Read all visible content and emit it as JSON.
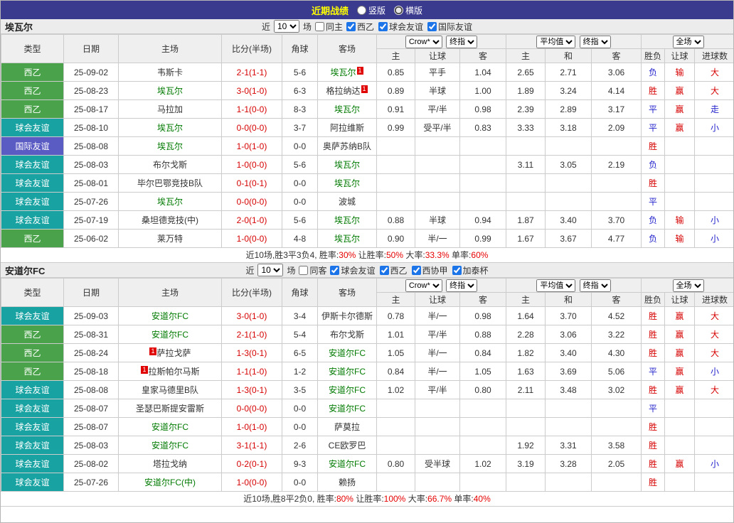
{
  "colors": {
    "title_bar": "#3a3a8e",
    "laliga2_green": "#4aa34a",
    "club_friendly_teal": "#18a2a2",
    "intl_friendly_blue": "#5b5bc4",
    "score_red": "#d60000",
    "self_team_green": "#007a00",
    "win_red": "#d60000",
    "draw_lose_blue": "#2323cc",
    "summary_red": "#e60000",
    "checkbox_blue": "#1c74e9"
  },
  "top_bar": {
    "title": "近期战绩",
    "radios": [
      {
        "label": "竖版",
        "checked": false
      },
      {
        "label": "横版",
        "checked": true
      }
    ]
  },
  "headers": {
    "type": "类型",
    "date": "日期",
    "home": "主场",
    "score": "比分(半场)",
    "corner": "角球",
    "away": "客场",
    "book": "Crow*",
    "final1": "终指",
    "avg": "平均值",
    "final2": "终指",
    "full": "全场",
    "sub": [
      "主",
      "让球",
      "客",
      "主",
      "和",
      "客",
      "胜负",
      "让球",
      "进球数"
    ]
  },
  "sections": [
    {
      "team": "埃瓦尔",
      "filter": {
        "near": "近",
        "count": "10",
        "games": "场",
        "same": "同主",
        "same_checked": false,
        "leagues": [
          {
            "label": "西乙",
            "checked": true
          },
          {
            "label": "球会友谊",
            "checked": true
          },
          {
            "label": "国际友谊",
            "checked": true
          }
        ]
      },
      "rows": [
        {
          "type": {
            "text": "西乙",
            "cls": "t-green"
          },
          "date": "25-09-02",
          "home": {
            "pre": "",
            "text": "韦斯卡",
            "post": "",
            "cls": ""
          },
          "score": "2-1(1-1)",
          "corner": "5-6",
          "away": {
            "pre": "",
            "text": "埃瓦尔",
            "post": "1",
            "cls": "green"
          },
          "o1": "0.85",
          "o2": "平手",
          "o3": "1.04",
          "a1": "2.65",
          "a2": "2.71",
          "a3": "3.06",
          "r1": {
            "t": "负",
            "c": "blue"
          },
          "r2": {
            "t": "输",
            "c": "red"
          },
          "r3": {
            "t": "大",
            "c": "red"
          }
        },
        {
          "type": {
            "text": "西乙",
            "cls": "t-green"
          },
          "date": "25-08-23",
          "home": {
            "pre": "",
            "text": "埃瓦尔",
            "post": "",
            "cls": "green"
          },
          "score": "3-0(1-0)",
          "corner": "6-3",
          "away": {
            "pre": "",
            "text": "格拉纳达",
            "post": "1",
            "cls": ""
          },
          "o1": "0.89",
          "o2": "半球",
          "o3": "1.00",
          "a1": "1.89",
          "a2": "3.24",
          "a3": "4.14",
          "r1": {
            "t": "胜",
            "c": "red"
          },
          "r2": {
            "t": "赢",
            "c": "red"
          },
          "r3": {
            "t": "大",
            "c": "red"
          }
        },
        {
          "type": {
            "text": "西乙",
            "cls": "t-green"
          },
          "date": "25-08-17",
          "home": {
            "pre": "",
            "text": "马拉加",
            "post": "",
            "cls": ""
          },
          "score": "1-1(0-0)",
          "corner": "8-3",
          "away": {
            "pre": "",
            "text": "埃瓦尔",
            "post": "",
            "cls": "green"
          },
          "o1": "0.91",
          "o2": "平/半",
          "o3": "0.98",
          "a1": "2.39",
          "a2": "2.89",
          "a3": "3.17",
          "r1": {
            "t": "平",
            "c": "blue"
          },
          "r2": {
            "t": "赢",
            "c": "red"
          },
          "r3": {
            "t": "走",
            "c": "blue"
          }
        },
        {
          "type": {
            "text": "球会友谊",
            "cls": "t-teal"
          },
          "date": "25-08-10",
          "home": {
            "pre": "",
            "text": "埃瓦尔",
            "post": "",
            "cls": "green"
          },
          "score": "0-0(0-0)",
          "corner": "3-7",
          "away": {
            "pre": "",
            "text": "阿拉维斯",
            "post": "",
            "cls": ""
          },
          "o1": "0.99",
          "o2": "受平/半",
          "o3": "0.83",
          "a1": "3.33",
          "a2": "3.18",
          "a3": "2.09",
          "r1": {
            "t": "平",
            "c": "blue"
          },
          "r2": {
            "t": "赢",
            "c": "red"
          },
          "r3": {
            "t": "小",
            "c": "blue"
          }
        },
        {
          "type": {
            "text": "国际友谊",
            "cls": "t-blue"
          },
          "date": "25-08-08",
          "home": {
            "pre": "",
            "text": "埃瓦尔",
            "post": "",
            "cls": "green"
          },
          "score": "1-0(1-0)",
          "corner": "0-0",
          "away": {
            "pre": "",
            "text": "奥萨苏纳B队",
            "post": "",
            "cls": ""
          },
          "o1": "",
          "o2": "",
          "o3": "",
          "a1": "",
          "a2": "",
          "a3": "",
          "r1": {
            "t": "胜",
            "c": "red"
          },
          "r2": {
            "t": "",
            "c": ""
          },
          "r3": {
            "t": "",
            "c": ""
          }
        },
        {
          "type": {
            "text": "球会友谊",
            "cls": "t-teal"
          },
          "date": "25-08-03",
          "home": {
            "pre": "",
            "text": "布尔戈斯",
            "post": "",
            "cls": ""
          },
          "score": "1-0(0-0)",
          "corner": "5-6",
          "away": {
            "pre": "",
            "text": "埃瓦尔",
            "post": "",
            "cls": "green"
          },
          "o1": "",
          "o2": "",
          "o3": "",
          "a1": "3.11",
          "a2": "3.05",
          "a3": "2.19",
          "r1": {
            "t": "负",
            "c": "blue"
          },
          "r2": {
            "t": "",
            "c": ""
          },
          "r3": {
            "t": "",
            "c": ""
          }
        },
        {
          "type": {
            "text": "球会友谊",
            "cls": "t-teal"
          },
          "date": "25-08-01",
          "home": {
            "pre": "",
            "text": "毕尔巴鄂竞技B队",
            "post": "",
            "cls": ""
          },
          "score": "0-1(0-1)",
          "corner": "0-0",
          "away": {
            "pre": "",
            "text": "埃瓦尔",
            "post": "",
            "cls": "green"
          },
          "o1": "",
          "o2": "",
          "o3": "",
          "a1": "",
          "a2": "",
          "a3": "",
          "r1": {
            "t": "胜",
            "c": "red"
          },
          "r2": {
            "t": "",
            "c": ""
          },
          "r3": {
            "t": "",
            "c": ""
          }
        },
        {
          "type": {
            "text": "球会友谊",
            "cls": "t-teal"
          },
          "date": "25-07-26",
          "home": {
            "pre": "",
            "text": "埃瓦尔",
            "post": "",
            "cls": "green"
          },
          "score": "0-0(0-0)",
          "corner": "0-0",
          "away": {
            "pre": "",
            "text": "波城",
            "post": "",
            "cls": ""
          },
          "o1": "",
          "o2": "",
          "o3": "",
          "a1": "",
          "a2": "",
          "a3": "",
          "r1": {
            "t": "平",
            "c": "blue"
          },
          "r2": {
            "t": "",
            "c": ""
          },
          "r3": {
            "t": "",
            "c": ""
          }
        },
        {
          "type": {
            "text": "球会友谊",
            "cls": "t-teal"
          },
          "date": "25-07-19",
          "home": {
            "pre": "",
            "text": "桑坦德竞技(中)",
            "post": "",
            "cls": ""
          },
          "score": "2-0(1-0)",
          "corner": "5-6",
          "away": {
            "pre": "",
            "text": "埃瓦尔",
            "post": "",
            "cls": "green"
          },
          "o1": "0.88",
          "o2": "半球",
          "o3": "0.94",
          "a1": "1.87",
          "a2": "3.40",
          "a3": "3.70",
          "r1": {
            "t": "负",
            "c": "blue"
          },
          "r2": {
            "t": "输",
            "c": "red"
          },
          "r3": {
            "t": "小",
            "c": "blue"
          }
        },
        {
          "type": {
            "text": "西乙",
            "cls": "t-green"
          },
          "date": "25-06-02",
          "home": {
            "pre": "",
            "text": "莱万特",
            "post": "",
            "cls": ""
          },
          "score": "1-0(0-0)",
          "corner": "4-8",
          "away": {
            "pre": "",
            "text": "埃瓦尔",
            "post": "",
            "cls": "green"
          },
          "o1": "0.90",
          "o2": "半/一",
          "o3": "0.99",
          "a1": "1.67",
          "a2": "3.67",
          "a3": "4.77",
          "r1": {
            "t": "负",
            "c": "blue"
          },
          "r2": {
            "t": "输",
            "c": "red"
          },
          "r3": {
            "t": "小",
            "c": "blue"
          }
        }
      ],
      "summary": [
        {
          "t": "近10场,胜3平3负4, 胜率:",
          "c": ""
        },
        {
          "t": "30%",
          "c": "r"
        },
        {
          "t": " 让胜率:",
          "c": ""
        },
        {
          "t": "50%",
          "c": "r"
        },
        {
          "t": " 大率:",
          "c": ""
        },
        {
          "t": "33.3%",
          "c": "r"
        },
        {
          "t": " 单率:",
          "c": ""
        },
        {
          "t": "60%",
          "c": "r"
        }
      ]
    },
    {
      "team": "安道尔FC",
      "filter": {
        "near": "近",
        "count": "10",
        "games": "场",
        "same": "同客",
        "same_checked": false,
        "leagues": [
          {
            "label": "球会友谊",
            "checked": true
          },
          {
            "label": "西乙",
            "checked": true
          },
          {
            "label": "西协甲",
            "checked": true
          },
          {
            "label": "加泰杯",
            "checked": true
          }
        ]
      },
      "rows": [
        {
          "type": {
            "text": "球会友谊",
            "cls": "t-teal"
          },
          "date": "25-09-03",
          "home": {
            "pre": "",
            "text": "安道尔FC",
            "post": "",
            "cls": "green"
          },
          "score": "3-0(1-0)",
          "corner": "3-4",
          "away": {
            "pre": "",
            "text": "伊斯卡尔德斯",
            "post": "",
            "cls": ""
          },
          "o1": "0.78",
          "o2": "半/一",
          "o3": "0.98",
          "a1": "1.64",
          "a2": "3.70",
          "a3": "4.52",
          "r1": {
            "t": "胜",
            "c": "red"
          },
          "r2": {
            "t": "赢",
            "c": "red"
          },
          "r3": {
            "t": "大",
            "c": "red"
          }
        },
        {
          "type": {
            "text": "西乙",
            "cls": "t-green"
          },
          "date": "25-08-31",
          "home": {
            "pre": "",
            "text": "安道尔FC",
            "post": "",
            "cls": "green"
          },
          "score": "2-1(1-0)",
          "corner": "5-4",
          "away": {
            "pre": "",
            "text": "布尔戈斯",
            "post": "",
            "cls": ""
          },
          "o1": "1.01",
          "o2": "平/半",
          "o3": "0.88",
          "a1": "2.28",
          "a2": "3.06",
          "a3": "3.22",
          "r1": {
            "t": "胜",
            "c": "red"
          },
          "r2": {
            "t": "赢",
            "c": "red"
          },
          "r3": {
            "t": "大",
            "c": "red"
          }
        },
        {
          "type": {
            "text": "西乙",
            "cls": "t-green"
          },
          "date": "25-08-24",
          "home": {
            "pre": "1",
            "text": "萨拉戈萨",
            "post": "",
            "cls": ""
          },
          "score": "1-3(0-1)",
          "corner": "6-5",
          "away": {
            "pre": "",
            "text": "安道尔FC",
            "post": "",
            "cls": "green"
          },
          "o1": "1.05",
          "o2": "半/一",
          "o3": "0.84",
          "a1": "1.82",
          "a2": "3.40",
          "a3": "4.30",
          "r1": {
            "t": "胜",
            "c": "red"
          },
          "r2": {
            "t": "赢",
            "c": "red"
          },
          "r3": {
            "t": "大",
            "c": "red"
          }
        },
        {
          "type": {
            "text": "西乙",
            "cls": "t-green"
          },
          "date": "25-08-18",
          "home": {
            "pre": "1",
            "text": "拉斯帕尔马斯",
            "post": "",
            "cls": ""
          },
          "score": "1-1(1-0)",
          "corner": "1-2",
          "away": {
            "pre": "",
            "text": "安道尔FC",
            "post": "",
            "cls": "green"
          },
          "o1": "0.84",
          "o2": "半/一",
          "o3": "1.05",
          "a1": "1.63",
          "a2": "3.69",
          "a3": "5.06",
          "r1": {
            "t": "平",
            "c": "blue"
          },
          "r2": {
            "t": "赢",
            "c": "red"
          },
          "r3": {
            "t": "小",
            "c": "blue"
          }
        },
        {
          "type": {
            "text": "球会友谊",
            "cls": "t-teal"
          },
          "date": "25-08-08",
          "home": {
            "pre": "",
            "text": "皇家马德里B队",
            "post": "",
            "cls": ""
          },
          "score": "1-3(0-1)",
          "corner": "3-5",
          "away": {
            "pre": "",
            "text": "安道尔FC",
            "post": "",
            "cls": "green"
          },
          "o1": "1.02",
          "o2": "平/半",
          "o3": "0.80",
          "a1": "2.11",
          "a2": "3.48",
          "a3": "3.02",
          "r1": {
            "t": "胜",
            "c": "red"
          },
          "r2": {
            "t": "赢",
            "c": "red"
          },
          "r3": {
            "t": "大",
            "c": "red"
          }
        },
        {
          "type": {
            "text": "球会友谊",
            "cls": "t-teal"
          },
          "date": "25-08-07",
          "home": {
            "pre": "",
            "text": "圣瑟巴斯提安雷斯",
            "post": "",
            "cls": ""
          },
          "score": "0-0(0-0)",
          "corner": "0-0",
          "away": {
            "pre": "",
            "text": "安道尔FC",
            "post": "",
            "cls": "green"
          },
          "o1": "",
          "o2": "",
          "o3": "",
          "a1": "",
          "a2": "",
          "a3": "",
          "r1": {
            "t": "平",
            "c": "blue"
          },
          "r2": {
            "t": "",
            "c": ""
          },
          "r3": {
            "t": "",
            "c": ""
          }
        },
        {
          "type": {
            "text": "球会友谊",
            "cls": "t-teal"
          },
          "date": "25-08-07",
          "home": {
            "pre": "",
            "text": "安道尔FC",
            "post": "",
            "cls": "green"
          },
          "score": "1-0(1-0)",
          "corner": "0-0",
          "away": {
            "pre": "",
            "text": "萨莫拉",
            "post": "",
            "cls": ""
          },
          "o1": "",
          "o2": "",
          "o3": "",
          "a1": "",
          "a2": "",
          "a3": "",
          "r1": {
            "t": "胜",
            "c": "red"
          },
          "r2": {
            "t": "",
            "c": ""
          },
          "r3": {
            "t": "",
            "c": ""
          }
        },
        {
          "type": {
            "text": "球会友谊",
            "cls": "t-teal"
          },
          "date": "25-08-03",
          "home": {
            "pre": "",
            "text": "安道尔FC",
            "post": "",
            "cls": "green"
          },
          "score": "3-1(1-1)",
          "corner": "2-6",
          "away": {
            "pre": "",
            "text": "CE欧罗巴",
            "post": "",
            "cls": ""
          },
          "o1": "",
          "o2": "",
          "o3": "",
          "a1": "1.92",
          "a2": "3.31",
          "a3": "3.58",
          "r1": {
            "t": "胜",
            "c": "red"
          },
          "r2": {
            "t": "",
            "c": ""
          },
          "r3": {
            "t": "",
            "c": ""
          }
        },
        {
          "type": {
            "text": "球会友谊",
            "cls": "t-teal"
          },
          "date": "25-08-02",
          "home": {
            "pre": "",
            "text": "塔拉戈纳",
            "post": "",
            "cls": ""
          },
          "score": "0-2(0-1)",
          "corner": "9-3",
          "away": {
            "pre": "",
            "text": "安道尔FC",
            "post": "",
            "cls": "green"
          },
          "o1": "0.80",
          "o2": "受半球",
          "o3": "1.02",
          "a1": "3.19",
          "a2": "3.28",
          "a3": "2.05",
          "r1": {
            "t": "胜",
            "c": "red"
          },
          "r2": {
            "t": "赢",
            "c": "red"
          },
          "r3": {
            "t": "小",
            "c": "blue"
          }
        },
        {
          "type": {
            "text": "球会友谊",
            "cls": "t-teal"
          },
          "date": "25-07-26",
          "home": {
            "pre": "",
            "text": "安道尔FC(中)",
            "post": "",
            "cls": "green"
          },
          "score": "1-0(0-0)",
          "corner": "0-0",
          "away": {
            "pre": "",
            "text": "赖扬",
            "post": "",
            "cls": ""
          },
          "o1": "",
          "o2": "",
          "o3": "",
          "a1": "",
          "a2": "",
          "a3": "",
          "r1": {
            "t": "胜",
            "c": "red"
          },
          "r2": {
            "t": "",
            "c": ""
          },
          "r3": {
            "t": "",
            "c": ""
          }
        }
      ],
      "summary": [
        {
          "t": "近10场,胜8平2负0, 胜率:",
          "c": ""
        },
        {
          "t": "80%",
          "c": "r"
        },
        {
          "t": " 让胜率:",
          "c": ""
        },
        {
          "t": "100%",
          "c": "r"
        },
        {
          "t": " 大率:",
          "c": ""
        },
        {
          "t": "66.7%",
          "c": "r"
        },
        {
          "t": " 单率:",
          "c": ""
        },
        {
          "t": "40%",
          "c": "r"
        }
      ]
    }
  ]
}
